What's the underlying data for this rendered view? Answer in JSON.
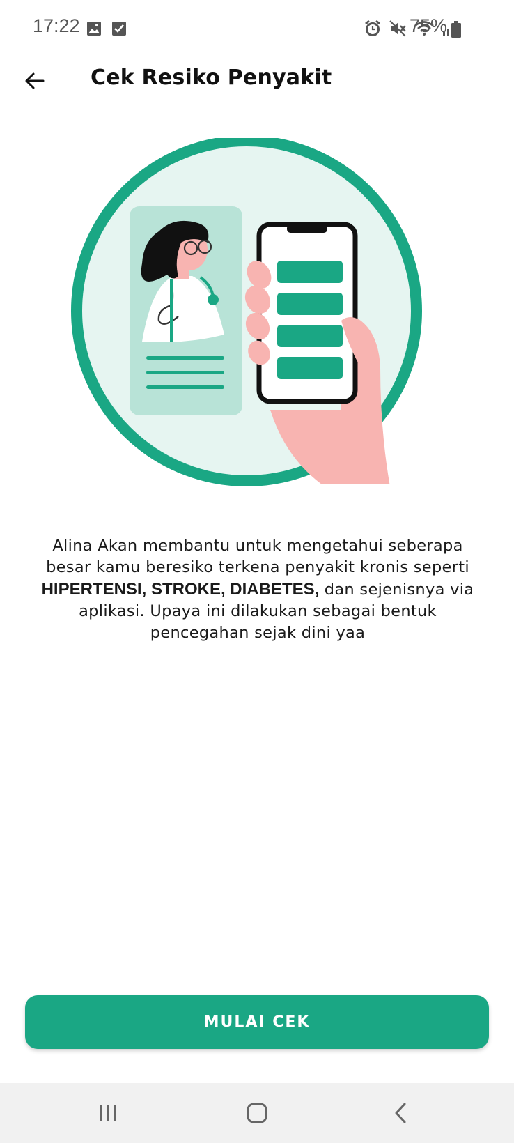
{
  "status_bar": {
    "time": "17:22",
    "battery": "75%",
    "left_icons": [
      "image-icon",
      "check-square-icon"
    ],
    "right_icons": [
      "alarm-icon",
      "mute-icon",
      "wifi-icon",
      "signal-icon",
      "battery-icon"
    ]
  },
  "app_bar": {
    "title": "Cek Resiko Penyakit",
    "back_icon": "arrow-left-icon"
  },
  "illustration": {
    "subject": "doctor-phone-illustration",
    "colors": {
      "ring": "#1aa784",
      "circle_fill": "#e6f5f1",
      "card": "#b8e3d7",
      "hand": "#f8b4b1",
      "phone_buttons": "#1aa784"
    }
  },
  "description": {
    "before": "Alina Akan membantu untuk mengetahui seberapa besar kamu beresiko terkena penyakit kronis seperti",
    "emphasis": "HIPERTENSI, STROKE, DIABETES,",
    "after": "dan sejenisnya via aplikasi. Upaya ini dilakukan sebagai bentuk pencegahan sejak dini yaa"
  },
  "cta": {
    "label": "MULAI CEK",
    "color": "#1aa784"
  },
  "nav_bar": {
    "buttons": [
      "recents-icon",
      "home-icon",
      "back-icon"
    ]
  }
}
